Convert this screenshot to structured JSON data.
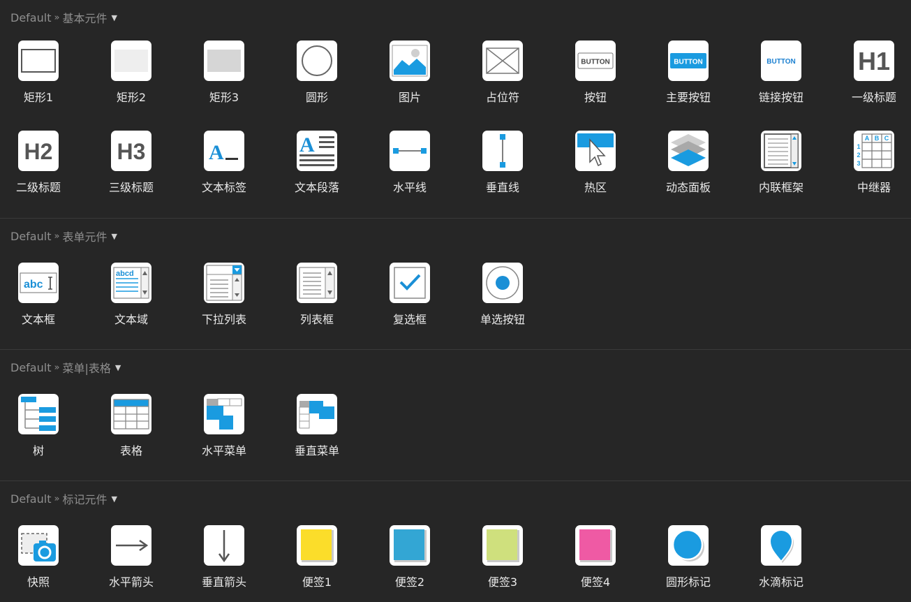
{
  "sections": [
    {
      "library": "Default",
      "separator": "»",
      "name": "基本元件",
      "items": [
        {
          "label": "矩形1",
          "icon": "rectangle-icon"
        },
        {
          "label": "矩形2",
          "icon": "rectangle-light-icon"
        },
        {
          "label": "矩形3",
          "icon": "rectangle-gray-icon"
        },
        {
          "label": "圆形",
          "icon": "circle-icon"
        },
        {
          "label": "图片",
          "icon": "image-icon"
        },
        {
          "label": "占位符",
          "icon": "placeholder-icon"
        },
        {
          "label": "按钮",
          "icon": "button-icon",
          "text": "BUTTON"
        },
        {
          "label": "主要按钮",
          "icon": "primary-button-icon",
          "text": "BUTTON"
        },
        {
          "label": "链接按钮",
          "icon": "link-button-icon",
          "text": "BUTTON"
        },
        {
          "label": "一级标题",
          "icon": "heading1-icon",
          "text": "H1"
        },
        {
          "label": "二级标题",
          "icon": "heading2-icon",
          "text": "H2"
        },
        {
          "label": "三级标题",
          "icon": "heading3-icon",
          "text": "H3"
        },
        {
          "label": "文本标签",
          "icon": "text-label-icon",
          "text": "A_"
        },
        {
          "label": "文本段落",
          "icon": "paragraph-icon",
          "text": "A"
        },
        {
          "label": "水平线",
          "icon": "horizontal-line-icon"
        },
        {
          "label": "垂直线",
          "icon": "vertical-line-icon"
        },
        {
          "label": "热区",
          "icon": "hotspot-icon"
        },
        {
          "label": "动态面板",
          "icon": "dynamic-panel-icon"
        },
        {
          "label": "内联框架",
          "icon": "inline-frame-icon"
        },
        {
          "label": "中继器",
          "icon": "repeater-icon",
          "text": [
            "A",
            "B",
            "C",
            "1",
            "2",
            "3"
          ]
        }
      ]
    },
    {
      "library": "Default",
      "separator": "»",
      "name": "表单元件",
      "items": [
        {
          "label": "文本框",
          "icon": "text-field-icon",
          "text": "abc"
        },
        {
          "label": "文本域",
          "icon": "text-area-icon",
          "text": "abcd"
        },
        {
          "label": "下拉列表",
          "icon": "droplist-icon"
        },
        {
          "label": "列表框",
          "icon": "list-box-icon"
        },
        {
          "label": "复选框",
          "icon": "checkbox-icon"
        },
        {
          "label": "单选按钮",
          "icon": "radio-button-icon"
        }
      ]
    },
    {
      "library": "Default",
      "separator": "»",
      "name": "菜单|表格",
      "items": [
        {
          "label": "树",
          "icon": "tree-icon"
        },
        {
          "label": "表格",
          "icon": "table-icon"
        },
        {
          "label": "水平菜单",
          "icon": "horizontal-menu-icon"
        },
        {
          "label": "垂直菜单",
          "icon": "vertical-menu-icon"
        }
      ]
    },
    {
      "library": "Default",
      "separator": "»",
      "name": "标记元件",
      "items": [
        {
          "label": "快照",
          "icon": "snapshot-icon"
        },
        {
          "label": "水平箭头",
          "icon": "horizontal-arrow-icon"
        },
        {
          "label": "垂直箭头",
          "icon": "vertical-arrow-icon"
        },
        {
          "label": "便签1",
          "icon": "sticky-yellow-icon"
        },
        {
          "label": "便签2",
          "icon": "sticky-blue-icon"
        },
        {
          "label": "便签3",
          "icon": "sticky-green-icon"
        },
        {
          "label": "便签4",
          "icon": "sticky-pink-icon"
        },
        {
          "label": "圆形标记",
          "icon": "circle-marker-icon"
        },
        {
          "label": "水滴标记",
          "icon": "drop-marker-icon"
        }
      ]
    }
  ],
  "colors": {
    "background": "#262626",
    "accent": "#1a9be0",
    "sticky_yellow": "#fbdd2a",
    "sticky_blue": "#33a6d4",
    "sticky_green": "#cfe07d",
    "sticky_pink": "#ef5aa4"
  }
}
